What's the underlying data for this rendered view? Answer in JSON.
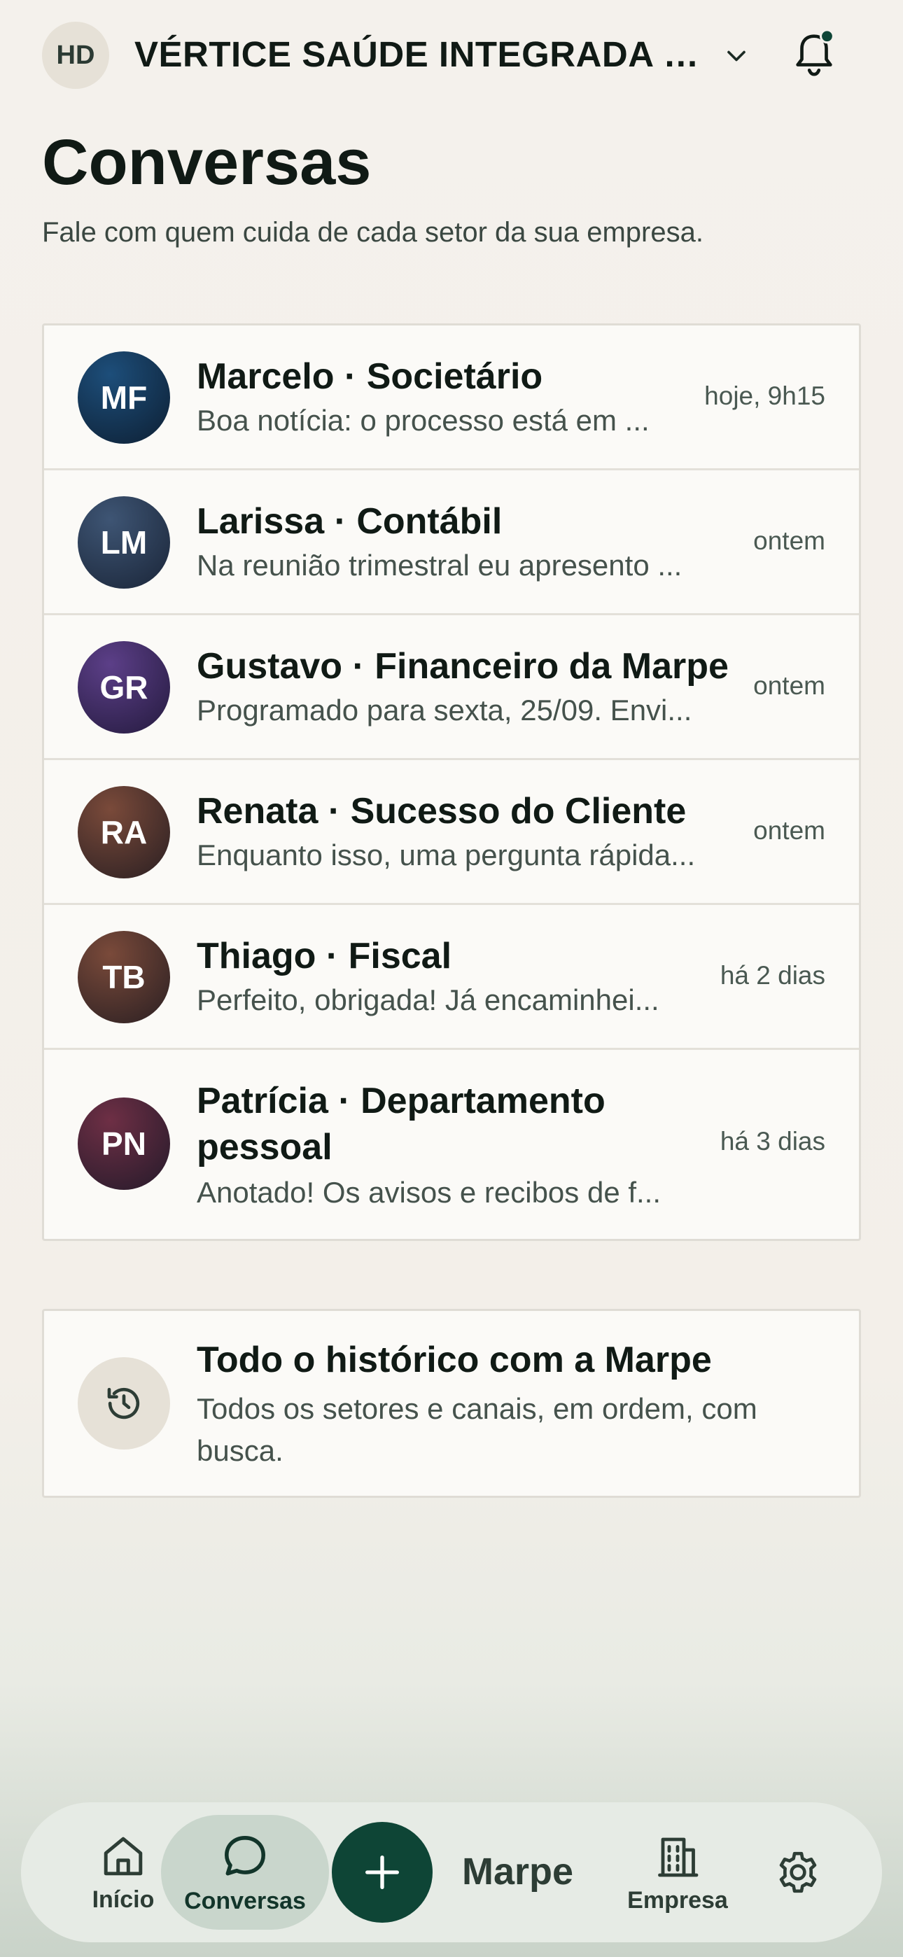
{
  "header": {
    "avatar_initials": "HD",
    "company_name": "VÉRTICE SAÚDE INTEGRADA L...",
    "has_notification_dot": true,
    "notification_dot_color": "#0e4536"
  },
  "page": {
    "title": "Conversas",
    "subtitle": "Fale com quem cuida de cada setor da sua empresa."
  },
  "conversations": [
    {
      "initials": "MF",
      "name": "Marcelo · Societário",
      "preview": "Boa notícia: o processo está em ...",
      "time": "hoje, 9h15",
      "color_from": "#1d4e7a",
      "color_to": "#0d1f33"
    },
    {
      "initials": "LM",
      "name": "Larissa · Contábil",
      "preview": "Na reunião trimestral eu apresento ...",
      "time": "ontem",
      "color_from": "#3e5574",
      "color_to": "#1a2538"
    },
    {
      "initials": "GR",
      "name": "Gustavo · Financeiro da Marpe",
      "preview": "Programado para sexta, 25/09. Envi...",
      "time": "ontem",
      "color_from": "#5c3f88",
      "color_to": "#241a3e"
    },
    {
      "initials": "RA",
      "name": "Renata · Sucesso do Cliente",
      "preview": "Enquanto isso, uma pergunta rápida...",
      "time": "ontem",
      "color_from": "#7a4a3a",
      "color_to": "#2a1f22"
    },
    {
      "initials": "TB",
      "name": "Thiago · Fiscal",
      "preview": "Perfeito, obrigada! Já encaminhei...",
      "time": "há 2 dias",
      "color_from": "#7a4a3a",
      "color_to": "#2a1f22"
    },
    {
      "initials": "PN",
      "name": "Patrícia · Departamento pessoal",
      "preview": "Anotado! Os avisos e recibos de f...",
      "time": "há 3 dias",
      "color_from": "#6e2f45",
      "color_to": "#241a2a"
    }
  ],
  "history": {
    "title": "Todo o histórico com a Marpe",
    "description": "Todos os setores e canais, em ordem, com busca.",
    "icon": "history-icon"
  },
  "nav": {
    "inicio_label": "Início",
    "conversas_label": "Conversas",
    "brand": "Marpe",
    "empresa_label": "Empresa",
    "active": "conversas",
    "accent_color": "#0e4536"
  }
}
